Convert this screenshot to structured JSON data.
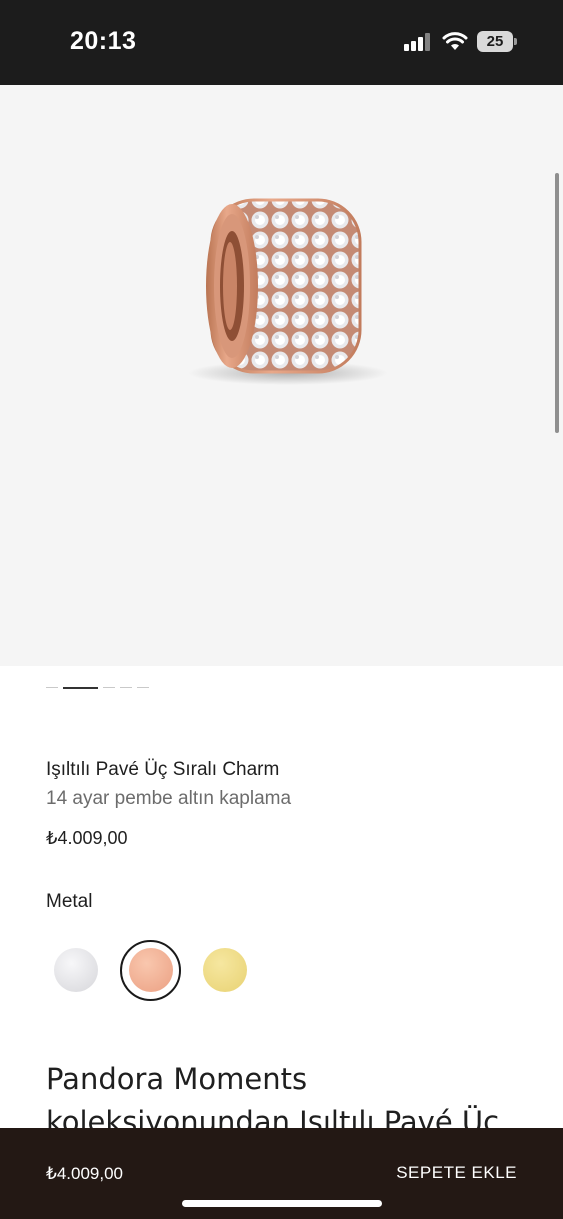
{
  "status_bar": {
    "time": "20:13",
    "battery": "25",
    "icons": [
      "signal-icon",
      "wifi-icon",
      "battery-icon"
    ]
  },
  "gallery": {
    "image_subject": "rose gold pavé charm",
    "slide_count": 5,
    "active_slide": 2
  },
  "product": {
    "title": "Işıltılı Pavé Üç Sıralı Charm",
    "subtitle": "14 ayar pembe altın kaplama",
    "price": "₺4.009,00"
  },
  "metal": {
    "label": "Metal",
    "options": [
      {
        "name": "silver",
        "color": "#e3e3e6"
      },
      {
        "name": "rose gold",
        "color": "#f0b398",
        "selected": true
      },
      {
        "name": "gold",
        "color": "#eedb85"
      }
    ]
  },
  "description": {
    "text": "Pandora Moments koleksiyonundan Işıltılı Pavé Üç"
  },
  "bottom_bar": {
    "price": "₺4.009,00",
    "add_to_cart_label": "SEPETE EKLE"
  },
  "colors": {
    "status_bar_bg": "#1c1c1c",
    "bottom_bar_bg": "#231814",
    "gallery_bg": "#f5f5f5"
  }
}
